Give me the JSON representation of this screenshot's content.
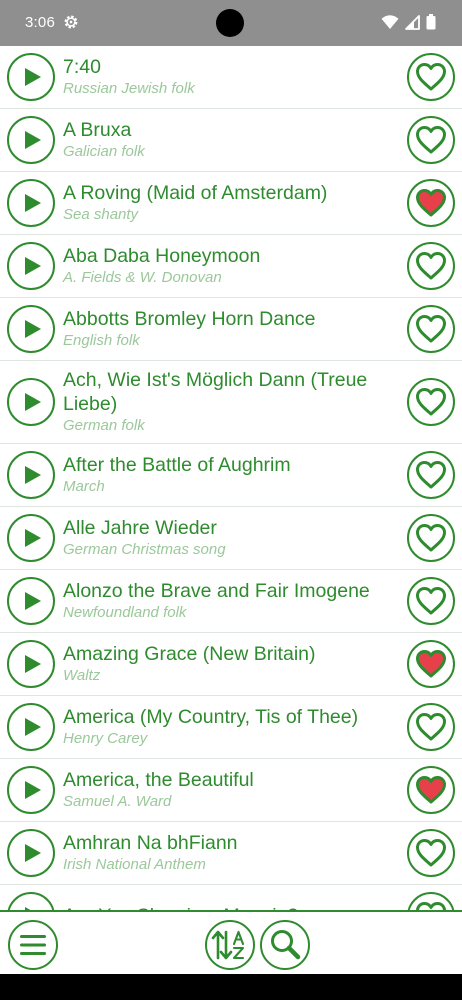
{
  "status_bar": {
    "time": "3:06"
  },
  "songs": [
    {
      "title": "7:40",
      "subtitle": "Russian Jewish folk",
      "favorite": false
    },
    {
      "title": "A Bruxa",
      "subtitle": "Galician folk",
      "favorite": false
    },
    {
      "title": "A Roving (Maid of Amsterdam)",
      "subtitle": "Sea shanty",
      "favorite": true
    },
    {
      "title": "Aba Daba Honeymoon",
      "subtitle": "A. Fields & W. Donovan",
      "favorite": false
    },
    {
      "title": "Abbotts Bromley Horn Dance",
      "subtitle": "English folk",
      "favorite": false
    },
    {
      "title": "Ach, Wie Ist's Möglich Dann (Treue Liebe)",
      "subtitle": "German folk",
      "favorite": false
    },
    {
      "title": "After the Battle of Aughrim",
      "subtitle": "March",
      "favorite": false
    },
    {
      "title": "Alle Jahre Wieder",
      "subtitle": "German Christmas song",
      "favorite": false
    },
    {
      "title": "Alonzo the Brave and Fair Imogene",
      "subtitle": "Newfoundland folk",
      "favorite": false
    },
    {
      "title": "Amazing Grace (New Britain)",
      "subtitle": "Waltz",
      "favorite": true
    },
    {
      "title": "America (My Country, Tis of Thee)",
      "subtitle": "Henry Carey",
      "favorite": false
    },
    {
      "title": "America, the Beautiful",
      "subtitle": "Samuel A. Ward",
      "favorite": true
    },
    {
      "title": "Amhran Na bhFiann",
      "subtitle": "Irish National Anthem",
      "favorite": false
    },
    {
      "title": "Are You Sleeping, Maggie?",
      "subtitle": "",
      "favorite": false
    }
  ],
  "toolbar": {
    "menu_icon": "hamburger-menu-icon",
    "sort_icon": "sort-alpha-icon",
    "search_icon": "magnifier-icon"
  },
  "colors": {
    "accent": "#2e8b2e",
    "subtitle": "#9bc89b",
    "favorite_fill": "#e8404a",
    "status_bar": "#8f8f8f"
  }
}
